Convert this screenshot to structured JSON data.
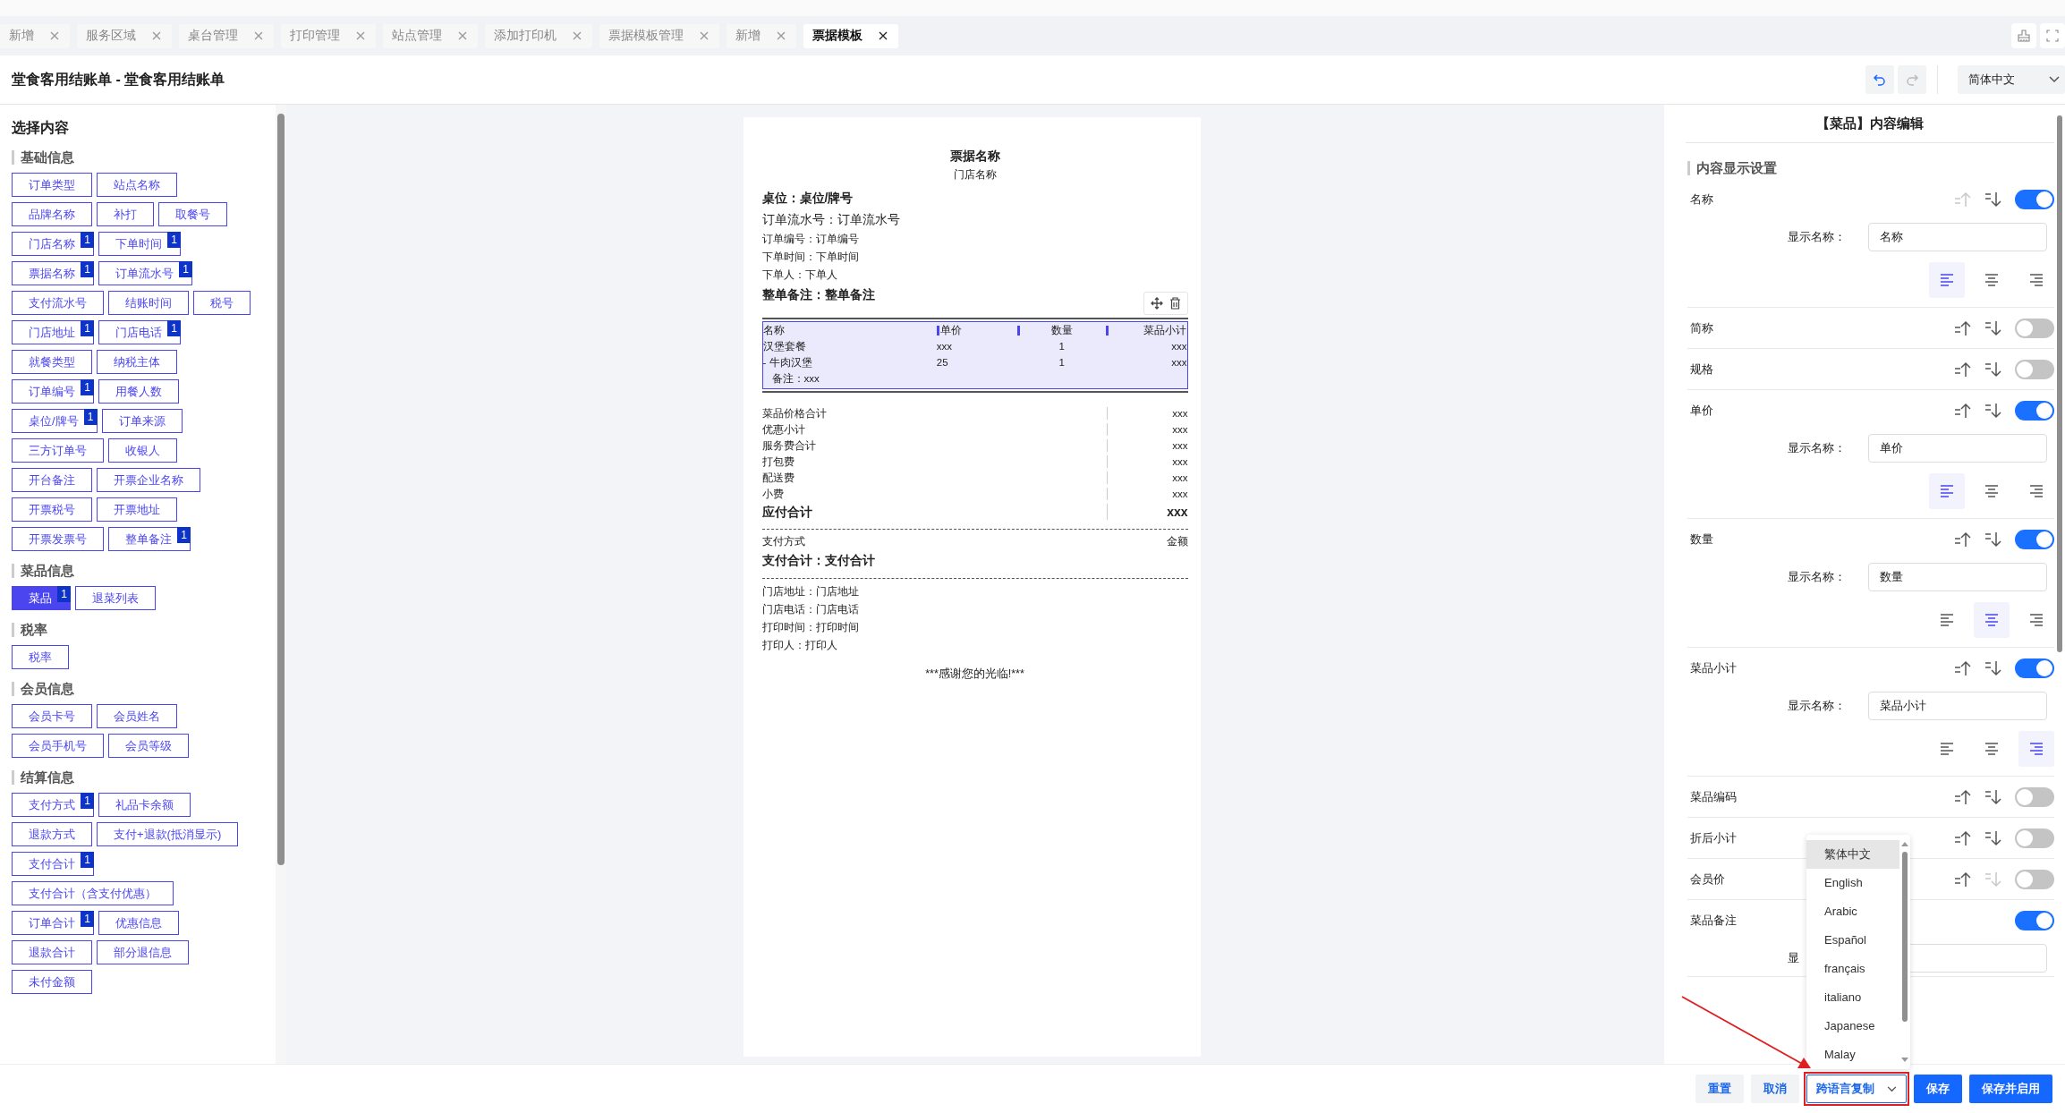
{
  "tabs": [
    {
      "label": "新增",
      "selected": false
    },
    {
      "label": "服务区域",
      "selected": false
    },
    {
      "label": "桌台管理",
      "selected": false
    },
    {
      "label": "打印管理",
      "selected": false
    },
    {
      "label": "站点管理",
      "selected": false
    },
    {
      "label": "添加打印机",
      "selected": false
    },
    {
      "label": "票据模板管理",
      "selected": false
    },
    {
      "label": "新增",
      "selected": false
    },
    {
      "label": "票据模板",
      "selected": true
    }
  ],
  "header": {
    "title": "堂食客用结账单 - 堂食客用结账单",
    "undo": {
      "disabled": false
    },
    "redo": {
      "disabled": true
    },
    "language": "简体中文"
  },
  "content_picker": {
    "title": "选择内容",
    "sections": [
      {
        "title": "基础信息",
        "rows": [
          [
            {
              "label": "订单类型",
              "selected": false
            },
            {
              "label": "站点名称",
              "selected": false
            }
          ],
          [
            {
              "label": "品牌名称",
              "selected": false
            },
            {
              "label": "补打",
              "selected": false
            },
            {
              "label": "取餐号",
              "selected": false
            }
          ],
          [
            {
              "label": "门店名称",
              "badge": "1",
              "selected": false
            },
            {
              "label": "下单时间",
              "badge": "1",
              "selected": false
            }
          ],
          [
            {
              "label": "票据名称",
              "badge": "1",
              "selected": false
            },
            {
              "label": "订单流水号",
              "badge": "1",
              "selected": false
            }
          ],
          [
            {
              "label": "支付流水号",
              "selected": false
            },
            {
              "label": "结账时间",
              "selected": false
            },
            {
              "label": "税号",
              "selected": false
            }
          ],
          [
            {
              "label": "门店地址",
              "badge": "1",
              "selected": false
            },
            {
              "label": "门店电话",
              "badge": "1",
              "selected": false
            }
          ],
          [
            {
              "label": "就餐类型",
              "selected": false
            },
            {
              "label": "纳税主体",
              "selected": false
            }
          ],
          [
            {
              "label": "订单编号",
              "badge": "1",
              "selected": false
            },
            {
              "label": "用餐人数",
              "selected": false
            }
          ],
          [
            {
              "label": "桌位/牌号",
              "badge": "1",
              "selected": false
            },
            {
              "label": "订单来源",
              "selected": false
            }
          ],
          [
            {
              "label": "三方订单号",
              "selected": false
            },
            {
              "label": "收银人",
              "selected": false
            }
          ],
          [
            {
              "label": "开台备注",
              "selected": false
            },
            {
              "label": "开票企业名称",
              "selected": false
            }
          ],
          [
            {
              "label": "开票税号",
              "selected": false
            },
            {
              "label": "开票地址",
              "selected": false
            }
          ],
          [
            {
              "label": "开票发票号",
              "selected": false
            },
            {
              "label": "整单备注",
              "badge": "1",
              "selected": false
            }
          ]
        ]
      },
      {
        "title": "菜品信息",
        "rows": [
          [
            {
              "label": "菜品",
              "badge": "1",
              "selected": true
            },
            {
              "label": "退菜列表",
              "selected": false
            }
          ]
        ]
      },
      {
        "title": "税率",
        "rows": [
          [
            {
              "label": "税率",
              "selected": false
            }
          ]
        ]
      },
      {
        "title": "会员信息",
        "rows": [
          [
            {
              "label": "会员卡号",
              "selected": false
            },
            {
              "label": "会员姓名",
              "selected": false
            }
          ],
          [
            {
              "label": "会员手机号",
              "selected": false
            },
            {
              "label": "会员等级",
              "selected": false
            }
          ]
        ]
      },
      {
        "title": "结算信息",
        "rows": [
          [
            {
              "label": "支付方式",
              "badge": "1",
              "selected": false
            },
            {
              "label": "礼品卡余额",
              "selected": false
            }
          ],
          [
            {
              "label": "退款方式",
              "selected": false
            },
            {
              "label": "支付+退款(抵消显示)",
              "selected": false
            }
          ],
          [
            {
              "label": "支付合计",
              "badge": "1",
              "selected": false
            }
          ],
          [
            {
              "label": "支付合计（含支付优惠）",
              "selected": false
            }
          ],
          [
            {
              "label": "订单合计",
              "badge": "1",
              "selected": false
            },
            {
              "label": "优惠信息",
              "selected": false
            }
          ],
          [
            {
              "label": "退款合计",
              "selected": false
            },
            {
              "label": "部分退信息",
              "selected": false
            }
          ],
          [
            {
              "label": "未付金额",
              "selected": false
            }
          ]
        ]
      }
    ]
  },
  "receipt": {
    "title": "票据名称",
    "store": "门店名称",
    "header_lines": [
      {
        "text": "桌位：桌位/牌号",
        "kind": "bold"
      },
      {
        "text": "订单流水号：订单流水号",
        "kind": "large"
      },
      {
        "text": "订单编号：订单编号",
        "kind": "normal"
      },
      {
        "text": "下单时间：下单时间",
        "kind": "normal"
      },
      {
        "text": "下单人：下单人",
        "kind": "normal"
      },
      {
        "text": "整单备注：整单备注",
        "kind": "bold"
      }
    ],
    "items_table": {
      "selected": true,
      "columns": [
        "名称",
        "单价",
        "数量",
        "菜品小计"
      ],
      "rows": [
        [
          "汉堡套餐",
          "xxx",
          "1",
          "xxx"
        ],
        [
          "- 牛肉汉堡",
          "25",
          "1",
          "xxx"
        ]
      ],
      "note": "备注：xxx"
    },
    "totals": [
      {
        "label": "菜品价格合计",
        "value": "xxx",
        "kind": "normal"
      },
      {
        "label": "优惠小计",
        "value": "xxx",
        "kind": "normal"
      },
      {
        "label": "服务费合计",
        "value": "xxx",
        "kind": "normal"
      },
      {
        "label": "打包费",
        "value": "xxx",
        "kind": "normal"
      },
      {
        "label": "配送费",
        "value": "xxx",
        "kind": "normal"
      },
      {
        "label": "小费",
        "value": "xxx",
        "kind": "normal"
      },
      {
        "label": "应付合计",
        "value": "xxx",
        "kind": "bold"
      }
    ],
    "payment": {
      "label": "支付方式",
      "value": "金额"
    },
    "payment_total": "支付合计：支付合计",
    "footer_lines": [
      "门店地址：门店地址",
      "门店电话：门店电话",
      "打印时间：打印时间",
      "打印人：打印人"
    ],
    "thanks": "***感谢您的光临!***"
  },
  "editor": {
    "title": "【菜品】内容编辑",
    "section": "内容显示设置",
    "fields": [
      {
        "name": "名称",
        "on": true,
        "sort": {
          "up_enabled": false,
          "down_enabled": true
        },
        "display_name": {
          "label": "显示名称：",
          "value": "名称"
        },
        "align_buttons": [
          {
            "kind": "left",
            "selected": true
          },
          {
            "kind": "center",
            "selected": false
          },
          {
            "kind": "right",
            "selected": false
          }
        ]
      },
      {
        "name": "简称",
        "on": false,
        "sort": {
          "up_enabled": true,
          "down_enabled": true
        }
      },
      {
        "name": "规格",
        "on": false,
        "sort": {
          "up_enabled": true,
          "down_enabled": true
        }
      },
      {
        "name": "单价",
        "on": true,
        "sort": {
          "up_enabled": true,
          "down_enabled": true
        },
        "display_name": {
          "label": "显示名称：",
          "value": "单价"
        },
        "align_buttons": [
          {
            "kind": "left",
            "selected": true
          },
          {
            "kind": "center",
            "selected": false
          },
          {
            "kind": "right",
            "selected": false
          }
        ]
      },
      {
        "name": "数量",
        "on": true,
        "sort": {
          "up_enabled": true,
          "down_enabled": true
        },
        "display_name": {
          "label": "显示名称：",
          "value": "数量"
        },
        "align_buttons": [
          {
            "kind": "left",
            "selected": false
          },
          {
            "kind": "center",
            "selected": true
          },
          {
            "kind": "right",
            "selected": false
          }
        ]
      },
      {
        "name": "菜品小计",
        "on": true,
        "sort": {
          "up_enabled": true,
          "down_enabled": true
        },
        "display_name": {
          "label": "显示名称：",
          "value": "菜品小计"
        },
        "align_buttons": [
          {
            "kind": "left",
            "selected": false
          },
          {
            "kind": "center",
            "selected": false
          },
          {
            "kind": "right",
            "selected": true
          }
        ]
      },
      {
        "name": "菜品编码",
        "on": false,
        "sort": {
          "up_enabled": true,
          "down_enabled": true
        }
      },
      {
        "name": "折后小计",
        "on": false,
        "sort": {
          "up_enabled": true,
          "down_enabled": true
        }
      },
      {
        "name": "会员价",
        "on": false,
        "sort": {
          "up_enabled": true,
          "down_enabled": false
        }
      },
      {
        "name": "菜品备注",
        "on": true,
        "display_name": {
          "label": "显"
        }
      }
    ]
  },
  "language_menu": {
    "items": [
      {
        "label": "繁体中文",
        "selected": true
      },
      {
        "label": "English",
        "selected": false
      },
      {
        "label": "Arabic",
        "selected": false
      },
      {
        "label": "Español",
        "selected": false
      },
      {
        "label": "français",
        "selected": false
      },
      {
        "label": "italiano",
        "selected": false
      },
      {
        "label": "Japanese",
        "selected": false
      },
      {
        "label": "Malay",
        "selected": false
      }
    ]
  },
  "footer_buttons": [
    {
      "label": "重置",
      "kind": "plain"
    },
    {
      "label": "取消",
      "kind": "plain"
    },
    {
      "label": "跨语言复制",
      "kind": "dropdown",
      "highlighted": true
    },
    {
      "label": "保存",
      "kind": "primary"
    },
    {
      "label": "保存并启用",
      "kind": "primary"
    }
  ]
}
